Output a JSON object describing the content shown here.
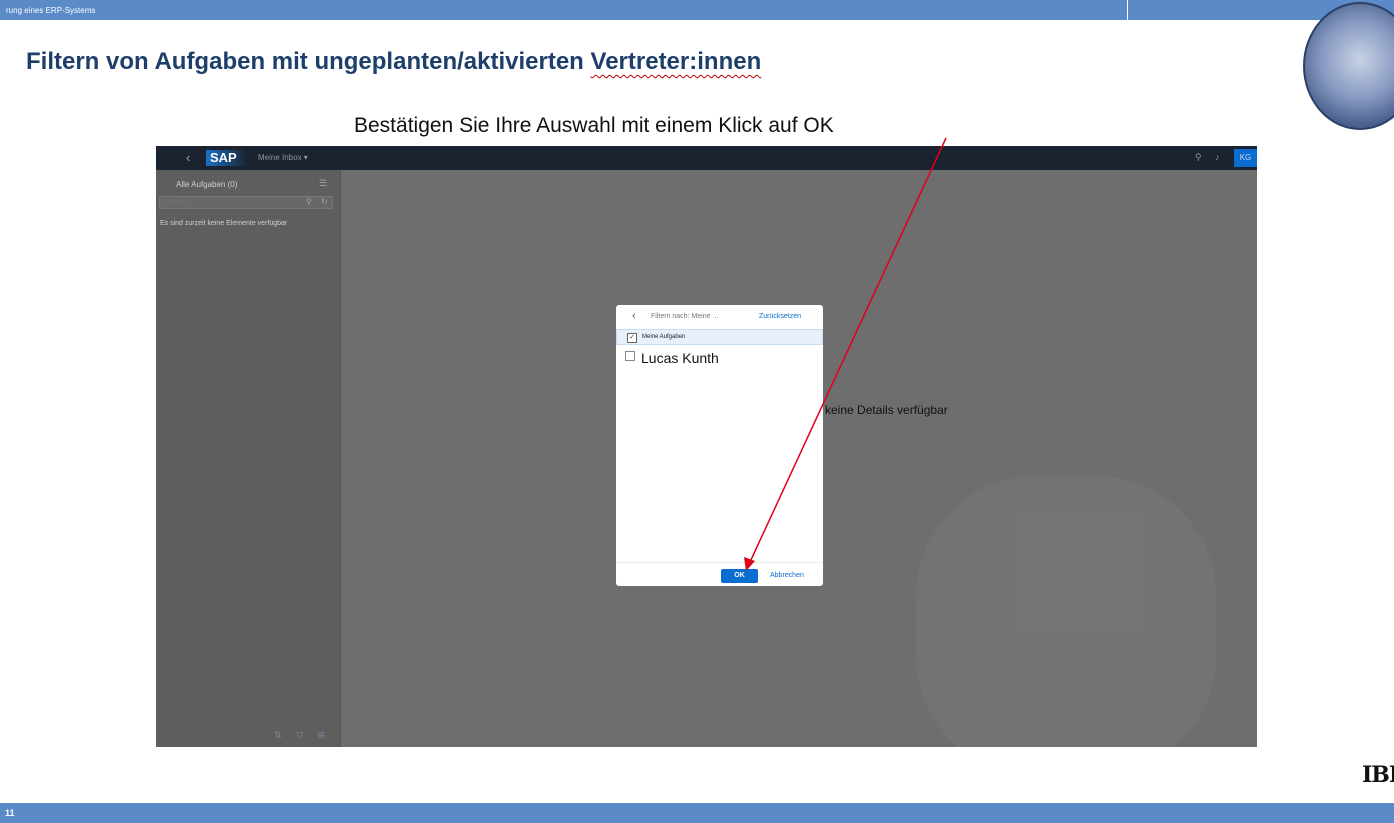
{
  "header": {
    "text": "rung eines ERP-Systems"
  },
  "slide": {
    "title_main": "Filtern von Aufgaben mit ungeplanten/aktivierten",
    "title_underlined": "Vertreter:innen",
    "instruction": "Bestätigen Sie Ihre Auswahl mit einem Klick auf OK"
  },
  "sap": {
    "logo": "SAP",
    "shell_title": "Meine Inbox ▾",
    "avatar": "KG",
    "list": {
      "header": "Alle Aufgaben (0)",
      "search_placeholder": "Suchen",
      "empty": "Es sind zurzeit keine Elemente verfügbar"
    },
    "detail_empty": "keine Details verfügbar"
  },
  "dialog": {
    "title": "Filtern nach: Meine ...",
    "reset": "Zurücksetzen",
    "options": [
      {
        "label": "Meine Aufgaben",
        "checked": true
      },
      {
        "label": "Lucas Kunth",
        "checked": false
      }
    ],
    "ok": "OK",
    "cancel": "Abbrechen"
  },
  "footer": {
    "page": "11",
    "logo": "IBI"
  },
  "colors": {
    "accent": "#0a6ed1",
    "slide_bar": "#5b8ac8",
    "arrow": "#e0001b"
  }
}
